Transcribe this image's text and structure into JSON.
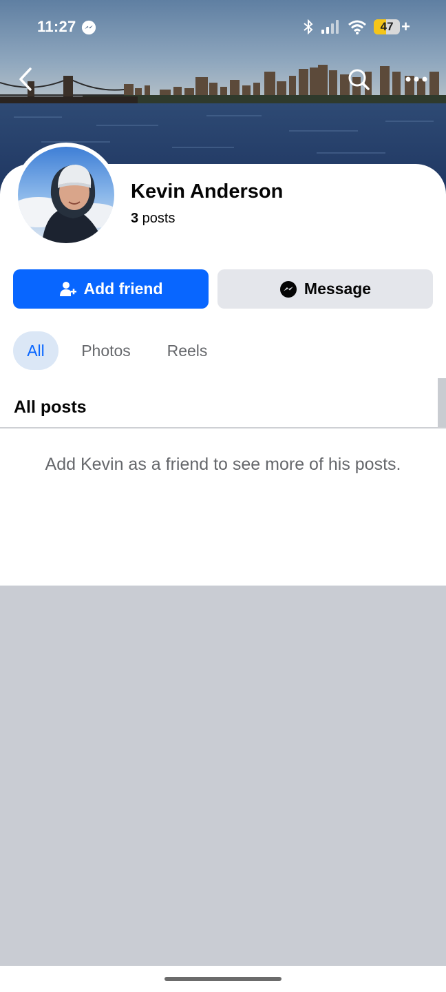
{
  "status_bar": {
    "time": "11:27",
    "battery_percent": "47",
    "battery_level": 0.47,
    "battery_color": "#f5c518",
    "icons": [
      "messenger-icon",
      "bluetooth-icon",
      "signal-icon",
      "wifi-icon",
      "battery-icon"
    ]
  },
  "nav": {
    "icons": [
      "back-chevron-icon",
      "search-icon",
      "more-icon"
    ]
  },
  "profile": {
    "name": "Kevin Anderson",
    "posts_count": "3",
    "posts_label": " posts"
  },
  "actions": {
    "add_friend_label": "Add friend",
    "message_label": "Message"
  },
  "tabs": [
    {
      "label": "All",
      "selected": true
    },
    {
      "label": "Photos",
      "selected": false
    },
    {
      "label": "Reels",
      "selected": false
    }
  ],
  "section": {
    "title": "All posts"
  },
  "notice": "Add Kevin as a friend to see more of his posts.",
  "colors": {
    "primary": "#0866ff",
    "secondary_button": "#e4e6eb",
    "muted_text": "#65676b",
    "tab_selected_bg": "#dbe7f6",
    "background_gray": "#c9ccd3"
  }
}
